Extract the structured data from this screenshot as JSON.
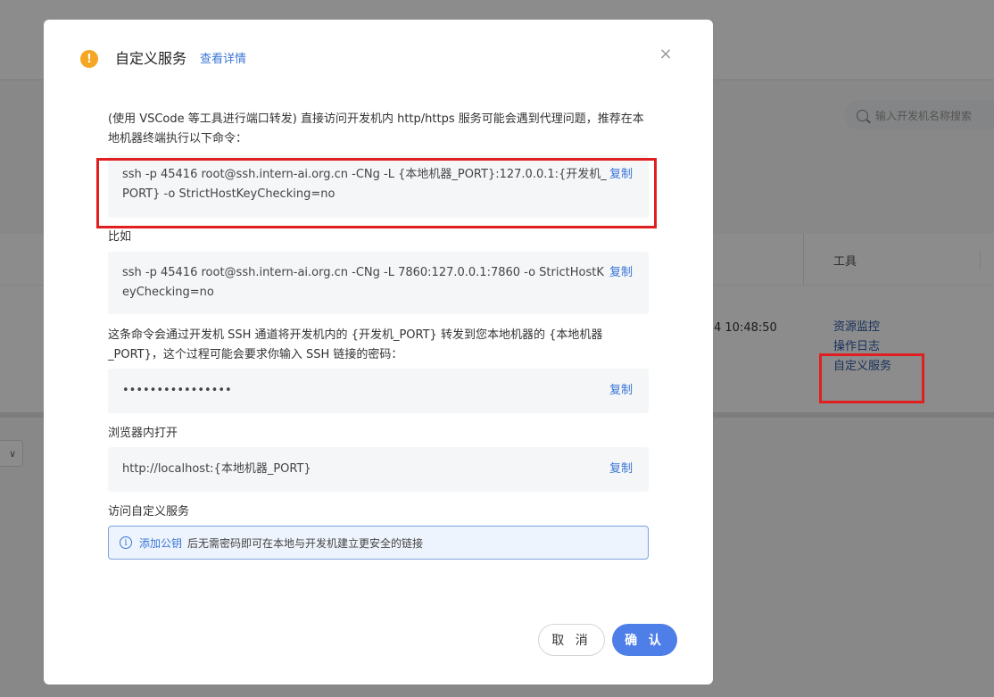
{
  "background": {
    "search_placeholder": "输入开发机名称搜索",
    "column_tools": "工具",
    "time_text": "4 10:48:50",
    "links": [
      "资源监控",
      "操作日志",
      "自定义服务"
    ],
    "select_arrow": "∨"
  },
  "modal": {
    "title": "自定义服务",
    "detail_link": "查看详情",
    "close": "×",
    "description": "(使用 VSCode 等工具进行端口转发) 直接访问开发机内 http/https 服务可能会遇到代理问题，推荐在本地机器终端执行以下命令：",
    "command": "ssh -p 45416 root@ssh.intern-ai.org.cn -CNg -L {本地机器_PORT}:127.0.0.1:{开发机_PORT} -o StrictHostKeyChecking=no",
    "example_label": "比如",
    "example_command": "ssh -p 45416 root@ssh.intern-ai.org.cn -CNg -L 7860:127.0.0.1:7860 -o StrictHostKeyChecking=no",
    "explain": "这条命令会通过开发机 SSH 通道将开发机内的 {开发机_PORT} 转发到您本地机器的 {本地机器_PORT}，这个过程可能会要求你输入 SSH 链接的密码：",
    "password_masked": "••••••••••••••••",
    "browser_label": "浏览器内打开",
    "browser_url": "http://localhost:{本地机器_PORT}",
    "access_label": "访问自定义服务",
    "info_link": "添加公钥",
    "info_text": "后无需密码即可在本地与开发机建立更安全的链接",
    "copy_label": "复制",
    "cancel": "取 消",
    "confirm": "确 认"
  },
  "colors": {
    "accent": "#4e7ee8",
    "link": "#3a75d6",
    "warning": "#f5a623",
    "highlight": "#e02020"
  }
}
